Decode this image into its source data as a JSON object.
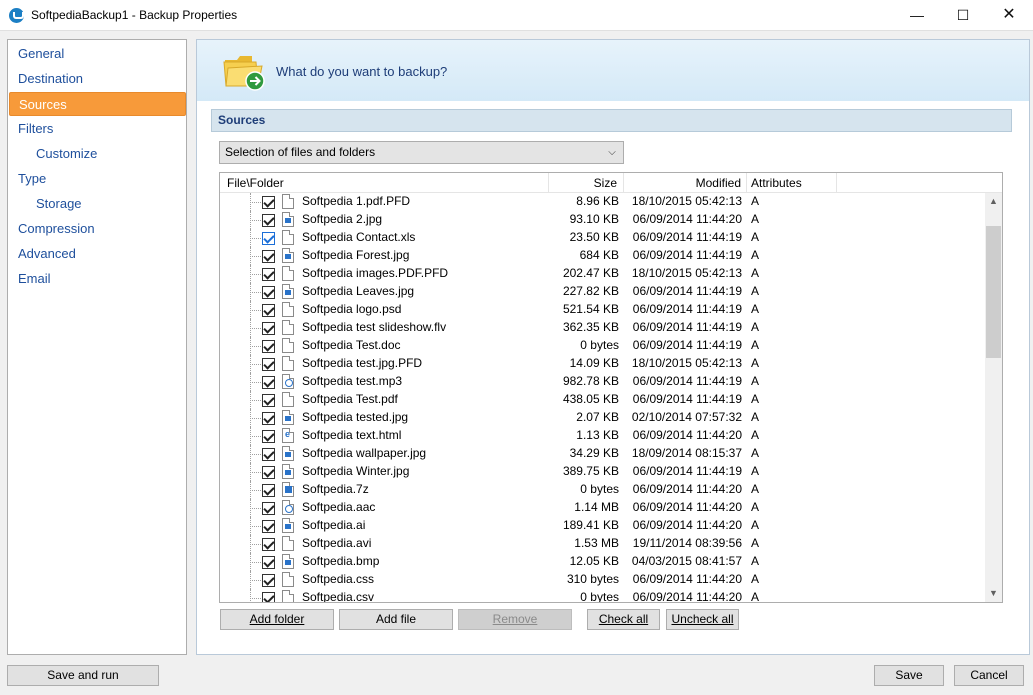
{
  "window": {
    "title": "SoftpediaBackup1 - Backup Properties",
    "minimize_glyph": "—",
    "maximize_glyph": "☐",
    "close_glyph": "✕"
  },
  "nav": {
    "items": [
      {
        "label": "General",
        "sub": false,
        "active": false
      },
      {
        "label": "Destination",
        "sub": false,
        "active": false
      },
      {
        "label": "Sources",
        "sub": false,
        "active": true
      },
      {
        "label": "Filters",
        "sub": false,
        "active": false
      },
      {
        "label": "Customize",
        "sub": true,
        "active": false
      },
      {
        "label": "Type",
        "sub": false,
        "active": false
      },
      {
        "label": "Storage",
        "sub": true,
        "active": false
      },
      {
        "label": "Compression",
        "sub": false,
        "active": false
      },
      {
        "label": "Advanced",
        "sub": false,
        "active": false
      },
      {
        "label": "Email",
        "sub": false,
        "active": false
      }
    ],
    "active_color": "#f79a3a"
  },
  "banner": {
    "question": "What do you want to backup?",
    "icon": "folder-add-icon"
  },
  "section": {
    "title": "Sources"
  },
  "source_mode": {
    "selected": "Selection of files and folders"
  },
  "file_list": {
    "columns": {
      "file": "File\\Folder",
      "size": "Size",
      "modified": "Modified",
      "attributes": "Attributes"
    },
    "rows": [
      {
        "name": "Softpedia 1.pdf.PFD",
        "size": "8.96 KB",
        "modified": "18/10/2015 05:42:13",
        "attr": "A",
        "icon": "document-icon",
        "checked": true
      },
      {
        "name": "Softpedia 2.jpg",
        "size": "93.10 KB",
        "modified": "06/09/2014 11:44:20",
        "attr": "A",
        "icon": "image-file-icon",
        "checked": true
      },
      {
        "name": "Softpedia Contact.xls",
        "size": "23.50 KB",
        "modified": "06/09/2014 11:44:19",
        "attr": "A",
        "icon": "document-icon",
        "checked": true
      },
      {
        "name": "Softpedia Forest.jpg",
        "size": "684 KB",
        "modified": "06/09/2014 11:44:19",
        "attr": "A",
        "icon": "image-file-icon",
        "checked": true
      },
      {
        "name": "Softpedia images.PDF.PFD",
        "size": "202.47 KB",
        "modified": "18/10/2015 05:42:13",
        "attr": "A",
        "icon": "document-icon",
        "checked": true
      },
      {
        "name": "Softpedia Leaves.jpg",
        "size": "227.82 KB",
        "modified": "06/09/2014 11:44:19",
        "attr": "A",
        "icon": "image-file-icon",
        "checked": true
      },
      {
        "name": "Softpedia logo.psd",
        "size": "521.54 KB",
        "modified": "06/09/2014 11:44:19",
        "attr": "A",
        "icon": "document-icon",
        "checked": true
      },
      {
        "name": "Softpedia test slideshow.flv",
        "size": "362.35 KB",
        "modified": "06/09/2014 11:44:19",
        "attr": "A",
        "icon": "document-icon",
        "checked": true
      },
      {
        "name": "Softpedia Test.doc",
        "size": "0 bytes",
        "modified": "06/09/2014 11:44:19",
        "attr": "A",
        "icon": "document-icon",
        "checked": true
      },
      {
        "name": "Softpedia test.jpg.PFD",
        "size": "14.09 KB",
        "modified": "18/10/2015 05:42:13",
        "attr": "A",
        "icon": "document-icon",
        "checked": true
      },
      {
        "name": "Softpedia test.mp3",
        "size": "982.78 KB",
        "modified": "06/09/2014 11:44:19",
        "attr": "A",
        "icon": "audio-file-icon",
        "checked": true
      },
      {
        "name": "Softpedia Test.pdf",
        "size": "438.05 KB",
        "modified": "06/09/2014 11:44:19",
        "attr": "A",
        "icon": "document-icon",
        "checked": true
      },
      {
        "name": "Softpedia tested.jpg",
        "size": "2.07 KB",
        "modified": "02/10/2014 07:57:32",
        "attr": "A",
        "icon": "image-file-icon",
        "checked": true
      },
      {
        "name": "Softpedia text.html",
        "size": "1.13 KB",
        "modified": "06/09/2014 11:44:20",
        "attr": "A",
        "icon": "web-file-icon",
        "checked": true
      },
      {
        "name": "Softpedia wallpaper.jpg",
        "size": "34.29 KB",
        "modified": "18/09/2014 08:15:37",
        "attr": "A",
        "icon": "image-file-icon",
        "checked": true
      },
      {
        "name": "Softpedia Winter.jpg",
        "size": "389.75 KB",
        "modified": "06/09/2014 11:44:19",
        "attr": "A",
        "icon": "image-file-icon",
        "checked": true
      },
      {
        "name": "Softpedia.7z",
        "size": "0 bytes",
        "modified": "06/09/2014 11:44:20",
        "attr": "A",
        "icon": "archive-file-icon",
        "checked": true
      },
      {
        "name": "Softpedia.aac",
        "size": "1.14 MB",
        "modified": "06/09/2014 11:44:20",
        "attr": "A",
        "icon": "audio-file-icon",
        "checked": true
      },
      {
        "name": "Softpedia.ai",
        "size": "189.41 KB",
        "modified": "06/09/2014 11:44:20",
        "attr": "A",
        "icon": "image-file-icon",
        "checked": true
      },
      {
        "name": "Softpedia.avi",
        "size": "1.53 MB",
        "modified": "19/11/2014 08:39:56",
        "attr": "A",
        "icon": "document-icon",
        "checked": true
      },
      {
        "name": "Softpedia.bmp",
        "size": "12.05 KB",
        "modified": "04/03/2015 08:41:57",
        "attr": "A",
        "icon": "image-file-icon",
        "checked": true
      },
      {
        "name": "Softpedia.css",
        "size": "310 bytes",
        "modified": "06/09/2014 11:44:20",
        "attr": "A",
        "icon": "document-icon",
        "checked": true
      },
      {
        "name": "Softpedia.csv",
        "size": "0 bytes",
        "modified": "06/09/2014 11:44:20",
        "attr": "A",
        "icon": "document-icon",
        "checked": true
      }
    ]
  },
  "list_buttons": {
    "add_folder": "Add folder",
    "add_file": "Add file",
    "remove": "Remove",
    "check_all": "Check all",
    "uncheck_all": "Uncheck all"
  },
  "footer": {
    "save_and_run": "Save and run",
    "save": "Save",
    "cancel": "Cancel"
  }
}
